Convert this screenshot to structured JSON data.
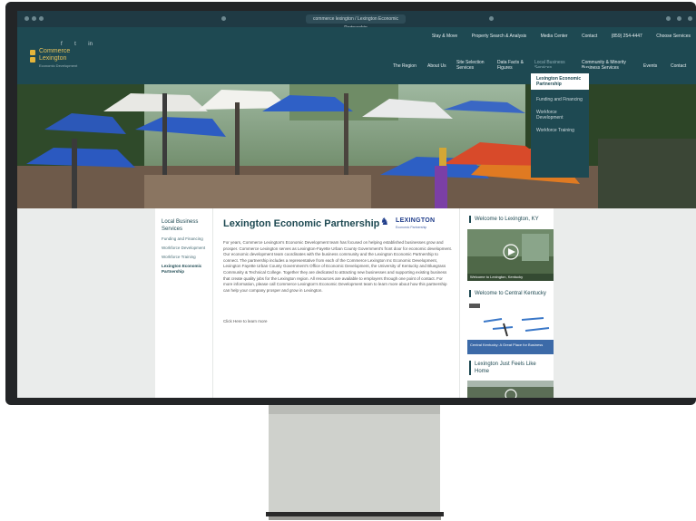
{
  "browser": {
    "url": "commerce lexington / Lexington Economic Partnership"
  },
  "header": {
    "logo": {
      "line1": "Commerce",
      "line2": "Lexington",
      "line3": "Economic Development"
    },
    "social": [
      "f",
      "t",
      "in"
    ],
    "top_links": [
      "Stay & Move",
      "Property Search & Analysis",
      "Media Center",
      "Contact",
      "(859) 254-4447",
      "Choose Services"
    ],
    "main_nav": [
      {
        "label": "The Region",
        "two_line": false
      },
      {
        "label": "About Us",
        "two_line": false
      },
      {
        "label": "Site Selection Services",
        "two_line": true
      },
      {
        "label": "Data Facts & Figures",
        "two_line": true
      },
      {
        "label": "Local Business Services",
        "two_line": true,
        "active": true
      },
      {
        "label": "Community & Minority Business Services",
        "two_line": true
      },
      {
        "label": "Events",
        "two_line": false
      },
      {
        "label": "Contact",
        "two_line": false
      }
    ]
  },
  "dropdown": {
    "items": [
      {
        "label": "Lexington Economic Partnership",
        "active": true
      },
      {
        "label": "Funding and Financing",
        "active": false
      },
      {
        "label": "Workforce Development",
        "active": false
      },
      {
        "label": "Workforce Training",
        "active": false
      }
    ]
  },
  "sidebar": {
    "title": "Local Business Services",
    "links": [
      {
        "label": "Funding and Financing",
        "active": false
      },
      {
        "label": "Workforce Development",
        "active": false
      },
      {
        "label": "Workforce Training",
        "active": false
      },
      {
        "label": "Lexington Economic Partnership",
        "active": true
      }
    ]
  },
  "content": {
    "title": "Lexington Economic Partnership",
    "partner_logo": {
      "name": "LEXINGTON",
      "sub": "Economic Partnership"
    },
    "body": "For years, Commerce Lexington's Economic Development team has focused on helping established businesses grow and prosper. Commerce Lexington serves as Lexington-Fayette Urban County Government's front door for economic development. Our economic development team coordinates with the business community and the Lexington Economic Partnership to connect. The partnership includes a representative from each of the Commerce Lexington Inc Economic Development, Lexington Fayette Urban County Government's Office of Economic Development, the University of Kentucky and Bluegrass Community & Technical College. Together they are dedicated to attracting new businesses and supporting existing business that create quality jobs for the Lexington region. All resources are available to employers through one point of contact. For more information, please call Commerce Lexington's Economic Development team to learn more about how this partnership can help your company prosper and grow in Lexington.",
    "more": "Click Here to learn more"
  },
  "right": {
    "items": [
      {
        "title": "Welcome to Lexington, KY",
        "caption": "Welcome to Lexington, Kentucky"
      },
      {
        "title": "Welcome to Central Kentucky",
        "caption": "Central Kentucky: A Great Place for Business"
      },
      {
        "title": "Lexington Just Feels Like Home",
        "caption": ""
      }
    ]
  }
}
